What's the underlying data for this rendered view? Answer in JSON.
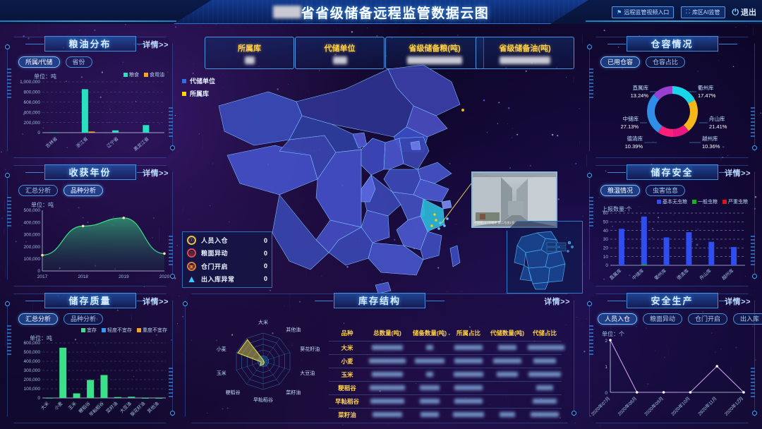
{
  "header": {
    "title_prefix_redacted": true,
    "title": "省省级储备远程监管数据云图",
    "buttons": [
      {
        "label": "远程监管视频入口",
        "icon": "flag-icon"
      },
      {
        "label": "库区AI监管",
        "icon": "building-icon"
      }
    ],
    "exit_label": "退出",
    "exit_icon": "power-icon"
  },
  "kpis": [
    {
      "label": "所属库",
      "value_redacted": true,
      "value_width": 14
    },
    {
      "label": "代储单位",
      "value_redacted": true,
      "value_width": 20
    },
    {
      "label": "省级储备粮(吨)",
      "value_redacted": true,
      "value_width": 72
    },
    {
      "label": "省级储备油(吨)",
      "value_redacted": true,
      "value_width": 68
    }
  ],
  "map": {
    "legend": [
      {
        "label": "代储单位",
        "color": "#2f6fe0"
      },
      {
        "label": "所属库",
        "color": "#ffd400"
      }
    ],
    "video_timestamp": "2020-10-19 09:07:38 星期一",
    "video_caption": "中储粮247号粮库 第二号房1号"
  },
  "alerts": {
    "items": [
      {
        "label": "人员入仓",
        "value": "0",
        "icon": "person-alert-icon",
        "color": "#e8c14a"
      },
      {
        "label": "粮面异动",
        "value": "0",
        "icon": "grain-alert-icon",
        "color": "#e04a4a"
      },
      {
        "label": "仓门开启",
        "value": "0",
        "icon": "door-alert-icon",
        "color": "#e07a3a"
      },
      {
        "label": "出入库异常",
        "value": "0",
        "icon": "warning-triangle-icon",
        "color": "#3ec8ff"
      }
    ]
  },
  "panels": {
    "grain_oil": {
      "title": "粮油分布",
      "more": "详情>>",
      "tabs": [
        {
          "label": "所属/代储",
          "active": true
        },
        {
          "label": "省份",
          "active": false
        }
      ],
      "unit": "单位：吨",
      "legend": [
        {
          "label": "粮食",
          "color": "#2ae0c0"
        },
        {
          "label": "食用油",
          "color": "#f0a81e"
        }
      ]
    },
    "harvest_year": {
      "title": "收获年份",
      "more": "详情>>",
      "tabs": [
        {
          "label": "汇总分析",
          "active": false
        },
        {
          "label": "品种分析",
          "active": true
        }
      ],
      "unit": "单位：吨"
    },
    "storage_quality": {
      "title": "储存质量",
      "more": "详情>>",
      "tabs": [
        {
          "label": "汇总分析",
          "active": true
        },
        {
          "label": "品种分析",
          "active": false
        }
      ],
      "unit": "单位：吨",
      "legend": [
        {
          "label": "宜存",
          "color": "#3ce08a"
        },
        {
          "label": "轻度不宜存",
          "color": "#2f9bff"
        },
        {
          "label": "重度不宜存",
          "color": "#f0a81e"
        }
      ]
    },
    "warehouse_capacity": {
      "title": "仓容情况",
      "tabs": [
        {
          "label": "已用仓容",
          "active": true
        },
        {
          "label": "仓容占比",
          "active": false
        }
      ]
    },
    "storage_safety": {
      "title": "储存安全",
      "more": "详情>>",
      "tabs": [
        {
          "label": "粮温情况",
          "active": true
        },
        {
          "label": "虫害信息",
          "active": false
        }
      ],
      "unit": "上报数量:个",
      "legend": [
        {
          "label": "基本无虫粮",
          "color": "#2f4ef0"
        },
        {
          "label": "一般虫粮",
          "color": "#14b814"
        },
        {
          "label": "严重虫粮",
          "color": "#e01414"
        }
      ]
    },
    "safe_production": {
      "title": "安全生产",
      "more": "详情>>",
      "tabs": [
        {
          "label": "人员入仓",
          "active": true
        },
        {
          "label": "粮面异动",
          "active": false
        },
        {
          "label": "仓门开启",
          "active": false
        },
        {
          "label": "出入库",
          "active": false
        }
      ],
      "unit": "单位：个"
    },
    "inventory_structure": {
      "title": "库存结构",
      "more": "详情>>"
    }
  },
  "chart_data": [
    {
      "id": "grain_oil_distribution",
      "type": "bar",
      "title": "粮油分布",
      "ylabel": "单位：吨",
      "categories": [
        "吉林省",
        "浙江省",
        "辽宁省",
        "黑龙江省"
      ],
      "series": [
        {
          "name": "粮食",
          "color": "#2ae0c0",
          "values": [
            8000,
            855000,
            45000,
            148000
          ]
        },
        {
          "name": "食用油",
          "color": "#f0a81e",
          "values": [
            0,
            22000,
            0,
            0
          ]
        }
      ],
      "ylim": [
        0,
        1000000
      ],
      "yticks": [
        0,
        200000,
        400000,
        600000,
        800000,
        1000000
      ],
      "ytick_labels": [
        "0",
        "200,000",
        "400,000",
        "600,000",
        "800,000",
        "1,000,000"
      ],
      "grid": true
    },
    {
      "id": "harvest_year",
      "type": "area",
      "title": "收获年份",
      "ylabel": "单位：吨",
      "categories": [
        "2017",
        "2018",
        "2019",
        "2020"
      ],
      "values": [
        130000,
        370000,
        437000,
        143000
      ],
      "color": "#3ce08a",
      "ylim": [
        0,
        500000
      ],
      "yticks": [
        0,
        100000,
        200000,
        300000,
        400000,
        500000
      ],
      "ytick_labels": [
        "0",
        "100,000",
        "200,000",
        "300,000",
        "400,000",
        "500,000"
      ],
      "grid": true
    },
    {
      "id": "storage_quality",
      "type": "bar",
      "title": "储存质量",
      "ylabel": "单位：吨",
      "categories": [
        "大米",
        "小麦",
        "玉米",
        "粳稻谷",
        "早籼稻谷",
        "菜籽油",
        "大豆油",
        "葵花籽油",
        "其他油"
      ],
      "series": [
        {
          "name": "宜存",
          "color": "#3ce08a",
          "values": [
            2000,
            548000,
            50000,
            196000,
            250000,
            10000,
            13000,
            1000,
            500
          ]
        }
      ],
      "ylim": [
        0,
        600000
      ],
      "yticks": [
        0,
        100000,
        200000,
        300000,
        400000,
        500000,
        600000
      ],
      "ytick_labels": [
        "0",
        "100,000",
        "200,000",
        "300,000",
        "400,000",
        "500,000",
        "600,000"
      ],
      "grid": true
    },
    {
      "id": "warehouse_capacity",
      "type": "pie",
      "title": "仓容情况",
      "labels": [
        "衢州库",
        "舟山库",
        "越州库",
        "德清库",
        "中储库",
        "直属库"
      ],
      "values": [
        17.47,
        21.41,
        10.36,
        10.39,
        27.13,
        13.24
      ],
      "value_labels": [
        "17.47%",
        "21.41%",
        "10.36%",
        "10.39%",
        "27.13%",
        "13.24%"
      ],
      "colors": [
        "#18d8e8",
        "#f5b81a",
        "#e8187f",
        "#ff1f7a",
        "#2f8fe8",
        "#9b3fd0"
      ]
    },
    {
      "id": "storage_safety",
      "type": "bar",
      "title": "储存安全",
      "ylabel": "上报数量:个",
      "categories": [
        "直属库",
        "中储库",
        "衢州库",
        "德清库",
        "舟山库",
        "越州库"
      ],
      "series": [
        {
          "name": "基本无虫粮",
          "color": "#2f4ef0",
          "values": [
            42,
            56,
            32,
            38,
            27,
            21
          ]
        },
        {
          "name": "一般虫粮",
          "color": "#14b814",
          "values": [
            0,
            1,
            0,
            0,
            0,
            0
          ]
        },
        {
          "name": "严重虫粮",
          "color": "#e01414",
          "values": [
            0,
            0,
            0,
            0,
            0,
            0
          ]
        }
      ],
      "ylim": [
        0,
        60
      ],
      "yticks": [
        0,
        10,
        20,
        30,
        40,
        50,
        60
      ],
      "ytick_labels": [
        "0",
        "10",
        "20",
        "30",
        "40",
        "50",
        "60"
      ],
      "grid": true
    },
    {
      "id": "safe_production",
      "type": "line",
      "title": "安全生产",
      "ylabel": "单位：个",
      "categories": [
        "2020年07月",
        "2020年08月",
        "2020年09月",
        "2020年10月",
        "2020年11月",
        "2020年12月"
      ],
      "values": [
        2,
        0,
        0,
        0,
        1,
        0
      ],
      "color": "#c89fe8",
      "ylim": [
        0,
        2
      ],
      "yticks": [
        0,
        1,
        2
      ],
      "ytick_labels": [
        "0",
        "1",
        "2"
      ],
      "grid": false
    },
    {
      "id": "variety_radar",
      "type": "radar",
      "title": "库存结构品种雷达",
      "axes": [
        "大米",
        "其他油",
        "葵花籽油",
        "大豆油",
        "菜籽油",
        "早籼稻谷",
        "粳稻谷",
        "玉米",
        "小麦"
      ],
      "values": [
        5,
        2,
        1,
        3,
        6,
        12,
        18,
        8,
        95
      ],
      "max": 100,
      "color": "#e8e04a"
    },
    {
      "id": "inventory_structure_table",
      "type": "table",
      "title": "库存结构",
      "columns": [
        "品种",
        "总数量(吨)",
        "储备数量(吨)",
        "所属占比",
        "代储数量(吨)",
        "代储占比"
      ],
      "rows": [
        {
          "name": "大米",
          "redacted": [
            44,
            10,
            40,
            26,
            52
          ]
        },
        {
          "name": "小麦",
          "redacted": [
            52,
            42,
            40,
            40,
            32
          ]
        },
        {
          "name": "玉米",
          "redacted": [
            44,
            10,
            42,
            30,
            46
          ]
        },
        {
          "name": "粳稻谷",
          "redacted": [
            50,
            28,
            40,
            0,
            24
          ]
        },
        {
          "name": "早籼稻谷",
          "redacted": [
            48,
            28,
            40,
            0,
            34
          ]
        },
        {
          "name": "菜籽油",
          "redacted": [
            42,
            26,
            44,
            22,
            40
          ]
        }
      ]
    }
  ]
}
